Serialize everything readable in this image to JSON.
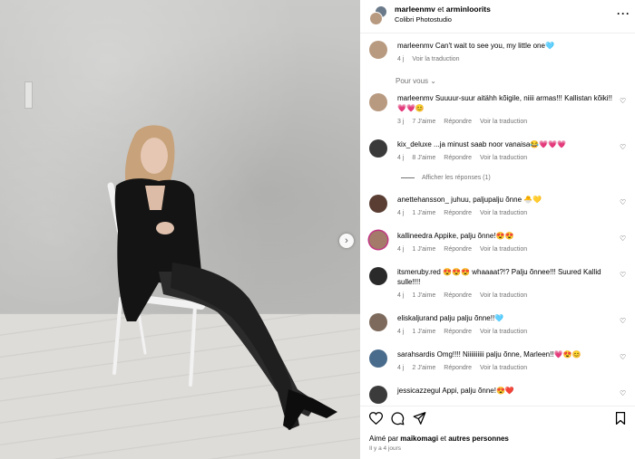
{
  "post": {
    "author": "marleenmv",
    "connector": "et",
    "coauthor": "arminloorits",
    "location": "Colibri Photostudio",
    "more_icon": "more-dots-icon"
  },
  "caption": {
    "user": "marleenmv",
    "text": "Can't wait to see you, my little one🩵",
    "time": "4 j",
    "translate": "Voir la traduction"
  },
  "for_you_label": "Pour vous",
  "comments": [
    {
      "user": "marleenmv",
      "text": "Suuuur-suur aitähh kõigile, niiii armas!!! Kallistan kõiki!! 💗💗😊",
      "time": "3 j",
      "likes": "7 J'aime",
      "reply": "Répondre",
      "translate": "Voir la traduction"
    },
    {
      "user": "kix_deluxe",
      "text": "...ja minust saab noor vanaisa😂💗💗💗",
      "time": "4 j",
      "likes": "8 J'aime",
      "reply": "Répondre",
      "translate": "Voir la traduction",
      "replies_label": "Afficher les réponses (1)"
    },
    {
      "user": "anettehansson_",
      "text": "juhuu, paljupalju õnne 🐣💛",
      "time": "4 j",
      "likes": "1 J'aime",
      "reply": "Répondre",
      "translate": "Voir la traduction"
    },
    {
      "user": "kallineedra",
      "text": "Appike, palju õnne!😍😍",
      "time": "4 j",
      "likes": "1 J'aime",
      "reply": "Répondre",
      "translate": "Voir la traduction"
    },
    {
      "user": "itsmeruby.red",
      "text": "😍😍😍 whaaaat?!? Palju õnnee!!! Suured Kallid sulle!!!!",
      "time": "4 j",
      "likes": "1 J'aime",
      "reply": "Répondre",
      "translate": "Voir la traduction"
    },
    {
      "user": "eliskaljurand",
      "text": "palju palju õnne!!🩵",
      "time": "4 j",
      "likes": "1 J'aime",
      "reply": "Répondre",
      "translate": "Voir la traduction"
    },
    {
      "user": "sarahsardis",
      "text": "Omg!!!! Niiiiiiiiii palju õnne, Marleen!!💗😍😊",
      "time": "4 j",
      "likes": "2 J'aime",
      "reply": "Répondre",
      "translate": "Voir la traduction"
    },
    {
      "user": "jessicazzegul",
      "text": "Appi, palju õnne!😍❤️",
      "time": "",
      "likes": "",
      "reply": "",
      "translate": ""
    }
  ],
  "footer": {
    "liked_prefix": "Aimé par",
    "liked_user": "maikomagi",
    "liked_mid": "et",
    "liked_rest": "autres personnes",
    "ago": "Il y a 4 jours"
  },
  "colors": {
    "meta": "#737373",
    "divider": "#efefef"
  }
}
